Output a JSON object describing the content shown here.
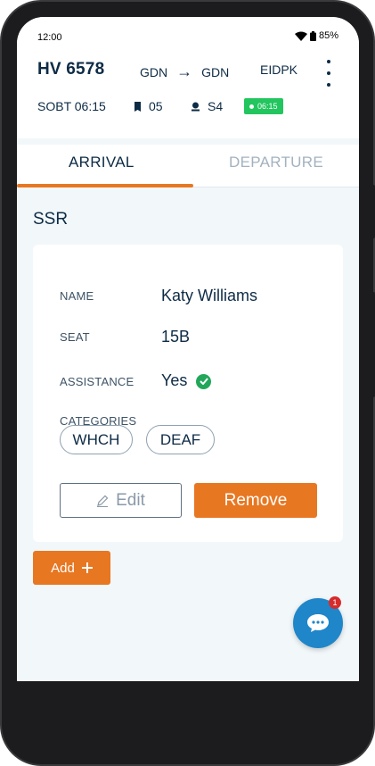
{
  "status_bar": {
    "time": "12:00",
    "battery": "85%"
  },
  "header": {
    "flight": "HV 6578",
    "route_from": "GDN",
    "route_arrow": "→",
    "route_to": "GDN",
    "registration": "EIDPK",
    "sobt_label": "SOBT",
    "sobt_time": "06:15",
    "gate": "05",
    "stand": "S4",
    "status_pill": "06:15"
  },
  "tabs": [
    {
      "label": "ARRIVAL",
      "active": true
    },
    {
      "label": "DEPARTURE",
      "active": false
    }
  ],
  "section": {
    "title": "SSR"
  },
  "ssr_card": {
    "name_label": "NAME",
    "name_value": "Katy Williams",
    "seat_label": "SEAT",
    "seat_value": "15B",
    "assistance_label": "ASSISTANCE",
    "assistance_value": "Yes",
    "categories_label": "CATEGORIES",
    "categories": [
      "WHCH",
      "DEAF"
    ],
    "edit_label": "Edit",
    "remove_label": "Remove"
  },
  "add_button": {
    "label": "Add"
  },
  "chat": {
    "badge_count": "1"
  },
  "colors": {
    "accent": "#e87722",
    "primary_text": "#0d2b45",
    "success": "#22a75a",
    "fab": "#1f86c9",
    "badge": "#d62b2b"
  }
}
